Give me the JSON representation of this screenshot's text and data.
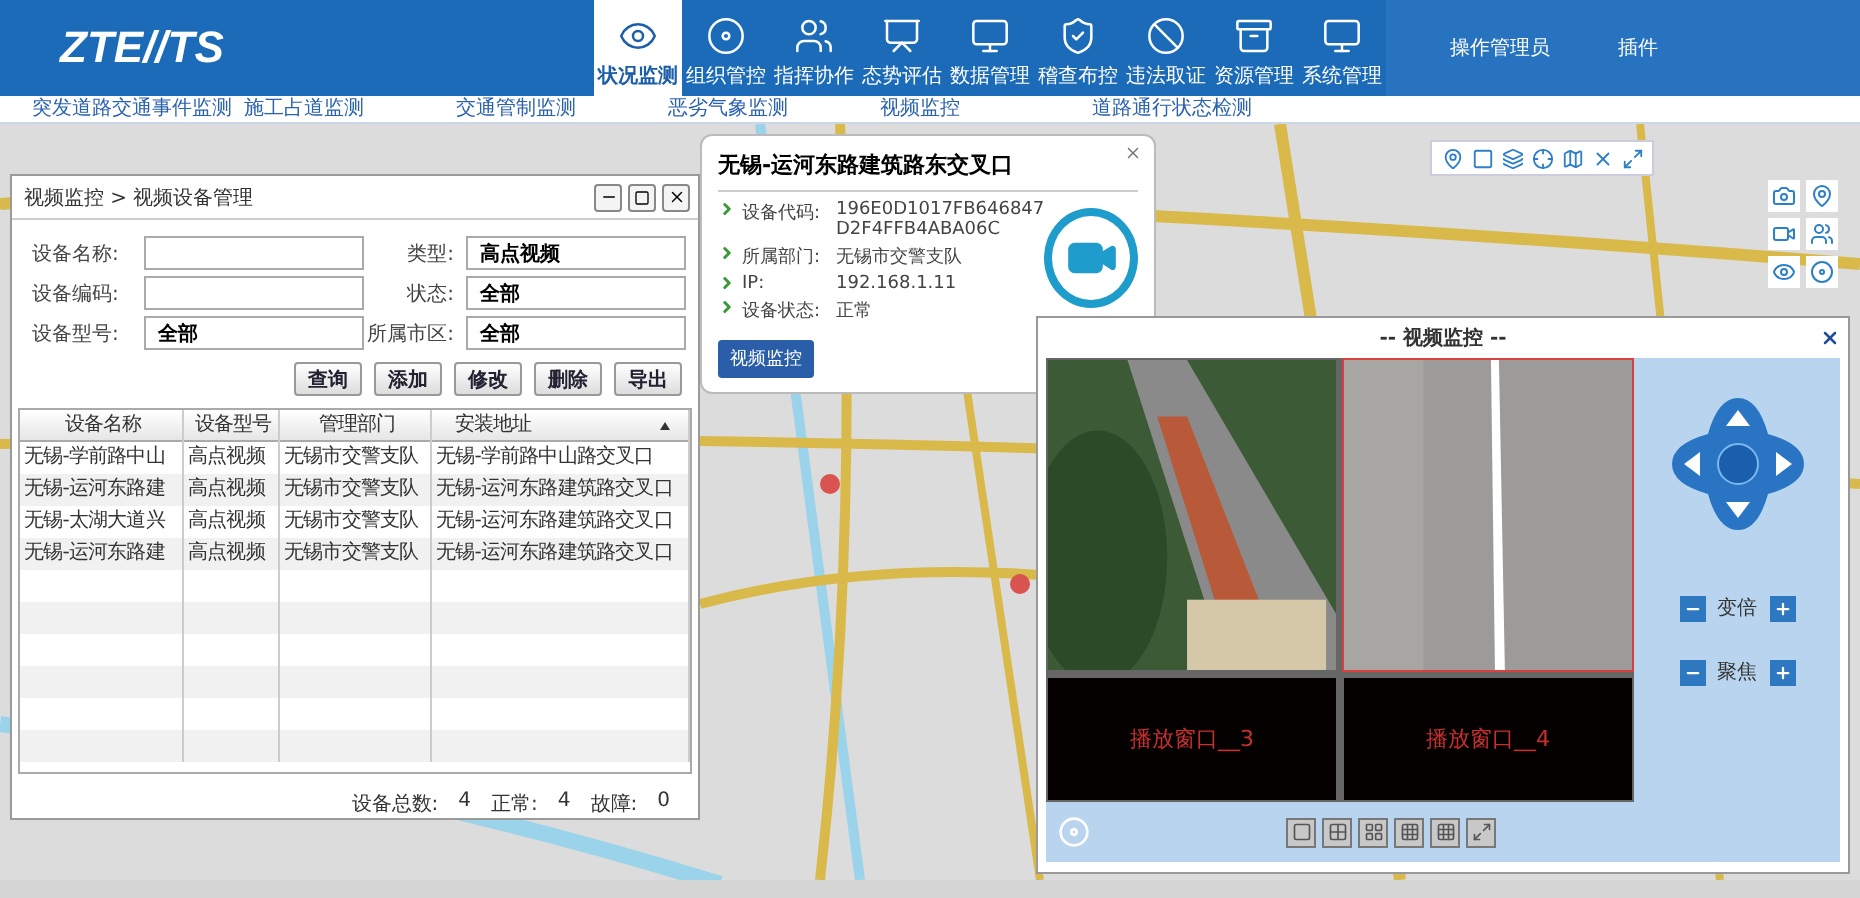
{
  "header": {
    "logo_main": "ZTE",
    "logo_sub": "//TS",
    "user": "操作管理员",
    "plugin": "插件"
  },
  "nav": [
    {
      "label": "状况监测",
      "selected": true
    },
    {
      "label": "组织管控",
      "selected": false
    },
    {
      "label": "指挥协作",
      "selected": false
    },
    {
      "label": "态势评估",
      "selected": false
    },
    {
      "label": "数据管理",
      "selected": false
    },
    {
      "label": "稽查布控",
      "selected": false
    },
    {
      "label": "违法取证",
      "selected": false
    },
    {
      "label": "资源管理",
      "selected": false
    },
    {
      "label": "系统管理",
      "selected": false
    }
  ],
  "subnav": [
    "突发道路交通事件监测",
    "施工占道监测",
    "交通管制监测",
    "恶劣气象监测",
    "视频监控",
    "道路通行状态检测"
  ],
  "device_window": {
    "breadcrumb": "视频监控 > 视频设备管理",
    "fields": [
      {
        "label": "设备名称:"
      },
      {
        "label": "类型:",
        "value": "高点视频"
      },
      {
        "label": "设备编码:"
      },
      {
        "label": "状态:",
        "value": "全部"
      },
      {
        "label": "设备型号:",
        "value": "全部"
      },
      {
        "label": "所属市区:",
        "value": "全部"
      }
    ],
    "buttons": [
      "查询",
      "添加",
      "修改",
      "删除",
      "导出"
    ],
    "table": {
      "columns": [
        "设备名称",
        "设备型号",
        "管理部门",
        "安装地址"
      ],
      "rows": [
        [
          "无锡-学前路中山",
          "高点视频",
          "无锡市交警支队",
          "无锡-学前路中山路交叉口"
        ],
        [
          "无锡-运河东路建",
          "高点视频",
          "无锡市交警支队",
          "无锡-运河东路建筑路交叉口"
        ],
        [
          "无锡-太湖大道兴",
          "高点视频",
          "无锡市交警支队",
          "无锡-运河东路建筑路交叉口"
        ],
        [
          "无锡-运河东路建",
          "高点视频",
          "无锡市交警支队",
          "无锡-运河东路建筑路交叉口"
        ]
      ]
    },
    "summary": [
      {
        "label": "设备总数:",
        "value": "4"
      },
      {
        "label": "正常:",
        "value": "4"
      },
      {
        "label": "故障:",
        "value": "0"
      }
    ]
  },
  "popup": {
    "title": "无锡-运河东路建筑路东交叉口",
    "rows": [
      {
        "label": "设备代码:",
        "lines": [
          "196E0D1017FB646847",
          "D2F4FFB4ABA06C"
        ]
      },
      {
        "label": "所属部门:",
        "lines": [
          "无锡市交警支队"
        ]
      },
      {
        "label": "IP:",
        "lines": [
          "192.168.1.11"
        ]
      },
      {
        "label": "设备状态:",
        "lines": [
          "正常"
        ]
      }
    ],
    "button": "视频监控"
  },
  "video_window": {
    "title": "-- 视频监控 --",
    "tiles": [
      {
        "kind": "trees",
        "selected": false
      },
      {
        "kind": "road",
        "selected": true
      },
      {
        "kind": "empty",
        "label": "播放窗口__3",
        "selected": false
      },
      {
        "kind": "empty",
        "label": "播放窗口__4",
        "selected": false
      }
    ],
    "controls": [
      "变倍",
      "聚焦"
    ]
  }
}
